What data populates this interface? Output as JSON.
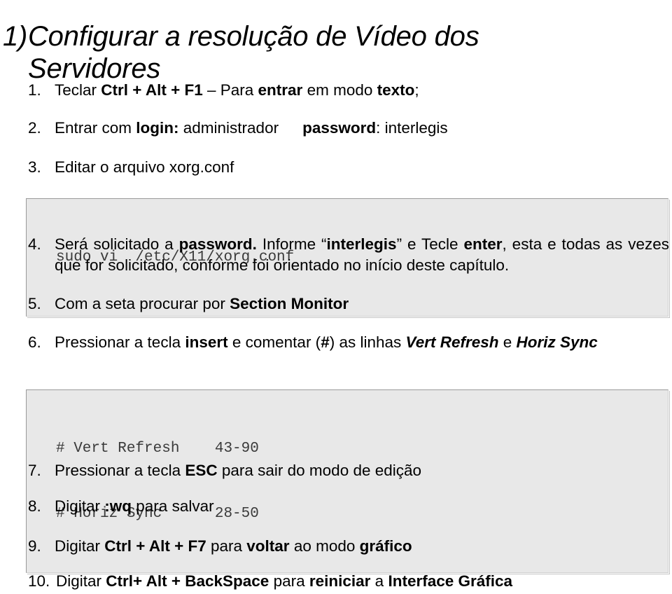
{
  "document": {
    "title": {
      "number": "1)",
      "line1": "Configurar a resolução de Vídeo dos",
      "line2": "Servidores"
    },
    "steps": [
      {
        "number": "1.",
        "segments": [
          {
            "text": "Teclar ",
            "style": "normal"
          },
          {
            "text": "Ctrl + Alt + F1",
            "style": "bold"
          },
          {
            "text": " – Para ",
            "style": "normal"
          },
          {
            "text": "entrar",
            "style": "bold"
          },
          {
            "text": " em modo ",
            "style": "normal"
          },
          {
            "text": "texto",
            "style": "bold"
          },
          {
            "text": ";",
            "style": "normal"
          }
        ],
        "plain": "Teclar Ctrl + Alt + F1 – Para entrar em modo texto;"
      },
      {
        "number": "2.",
        "segments": [
          {
            "text": "Entrar com ",
            "style": "normal"
          },
          {
            "text": "login:",
            "style": "bold"
          },
          {
            "text": " administrador",
            "style": "normal"
          },
          {
            "text": "",
            "style": "gap"
          },
          {
            "text": "password",
            "style": "bold"
          },
          {
            "text": ": interlegis",
            "style": "normal"
          }
        ],
        "plain": "Entrar com login: administrador    password: interlegis"
      },
      {
        "number": "3.",
        "segments": [
          {
            "text": "Editar o arquivo xorg.conf",
            "style": "normal"
          }
        ],
        "plain": "Editar o arquivo xorg.conf"
      },
      {
        "number": "4.",
        "segments": [
          {
            "text": "Será solicitado a ",
            "style": "normal"
          },
          {
            "text": "password.",
            "style": "bold"
          },
          {
            "text": " Informe “",
            "style": "normal"
          },
          {
            "text": "interlegis",
            "style": "bold"
          },
          {
            "text": "” e Tecle ",
            "style": "normal"
          },
          {
            "text": "enter",
            "style": "bold"
          },
          {
            "text": ", esta e todas as vezes que for solicitado, conforme foi orientado no início deste capítulo.",
            "style": "normal"
          }
        ],
        "plain": "Será solicitado a password. Informe “interlegis” e Tecle enter, esta e todas as vezes que for solicitado, conforme foi orientado no início deste capítulo."
      },
      {
        "number": "5.",
        "segments": [
          {
            "text": "Com a seta procurar por ",
            "style": "normal"
          },
          {
            "text": "Section Monitor",
            "style": "bold"
          }
        ],
        "plain": "Com a seta procurar por Section Monitor"
      },
      {
        "number": "6.",
        "segments": [
          {
            "text": "Pressionar a tecla ",
            "style": "normal"
          },
          {
            "text": "insert",
            "style": "bold"
          },
          {
            "text": " e comentar (",
            "style": "normal"
          },
          {
            "text": "#",
            "style": "bold"
          },
          {
            "text": ") as linhas ",
            "style": "normal"
          },
          {
            "text": "Vert Refresh",
            "style": "bold-italic"
          },
          {
            "text": " e ",
            "style": "normal"
          },
          {
            "text": "Horiz Sync",
            "style": "bold-italic"
          }
        ],
        "plain": "Pressionar a tecla insert e comentar (#) as linhas Vert Refresh e Horiz Sync"
      },
      {
        "number": "7.",
        "segments": [
          {
            "text": "Pressionar a tecla ",
            "style": "normal"
          },
          {
            "text": "ESC",
            "style": "bold"
          },
          {
            "text": " para sair do modo de edição",
            "style": "normal"
          }
        ],
        "plain": "Pressionar a tecla ESC para sair do modo de edição"
      },
      {
        "number": "8.",
        "segments": [
          {
            "text": "Digitar ",
            "style": "normal"
          },
          {
            "text": ":wq",
            "style": "bold"
          },
          {
            "text": " para salvar",
            "style": "normal"
          }
        ],
        "plain": "Digitar :wq para salvar"
      },
      {
        "number": "9.",
        "segments": [
          {
            "text": "Digitar ",
            "style": "normal"
          },
          {
            "text": "Ctrl + Alt + F7",
            "style": "bold"
          },
          {
            "text": " para ",
            "style": "normal"
          },
          {
            "text": "voltar",
            "style": "bold"
          },
          {
            "text": " ao modo ",
            "style": "normal"
          },
          {
            "text": "gráfico",
            "style": "bold"
          }
        ],
        "plain": "Digitar Ctrl + Alt + F7 para voltar ao modo gráfico"
      },
      {
        "number": "10.",
        "segments": [
          {
            "text": "Digitar ",
            "style": "normal"
          },
          {
            "text": "Ctrl+ Alt + BackSpace",
            "style": "bold"
          },
          {
            "text": " para ",
            "style": "normal"
          },
          {
            "text": "reiniciar",
            "style": "bold"
          },
          {
            "text": " a ",
            "style": "normal"
          },
          {
            "text": "Interface Gráfica",
            "style": "bold"
          }
        ],
        "plain": "Digitar Ctrl+ Alt + BackSpace para reiniciar a Interface Gráfica"
      }
    ],
    "code_blocks": [
      {
        "id": "edit-xorg-command",
        "lines": [
          "sudo vi  /etc/X11/xorg.conf"
        ]
      },
      {
        "id": "monitor-section-lines",
        "lines": [
          "# Vert Refresh    43-90",
          "# Horiz Sync      28-50"
        ]
      }
    ],
    "colors": {
      "code_background": "#e8e8e8",
      "code_border": "#9a9a9a",
      "text": "#000000",
      "page_background": "#ffffff"
    }
  }
}
